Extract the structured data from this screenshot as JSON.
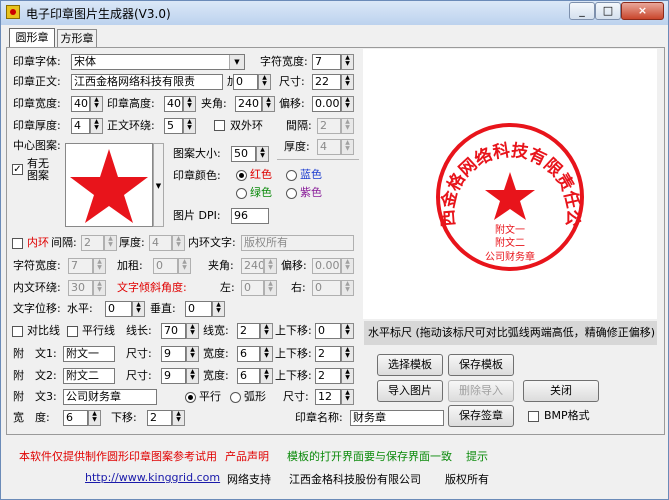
{
  "window": {
    "title": "电子印章图片生成器(V3.0)",
    "minimize": "_",
    "maximize": "□",
    "close": "×"
  },
  "tabs": [
    {
      "label": "圆形章",
      "active": true
    },
    {
      "label": "方形章",
      "active": false
    }
  ],
  "form": {
    "font_label": "印章字体:",
    "font_value": "宋体",
    "char_width_label": "字符宽度:",
    "char_width_value": "7",
    "main_text_label": "印章正文:",
    "main_text_value": "江西金格网络科技有限责",
    "bold_label": "加租:",
    "bold_value": "0",
    "size_label": "尺寸:",
    "size_value": "22",
    "stamp_width_label": "印章宽度:",
    "stamp_width_value": "40",
    "stamp_height_label": "印章高度:",
    "stamp_height_value": "40",
    "angle_label": "夹角:",
    "angle_value": "240",
    "offset_label": "偏移:",
    "offset_value": "0.000",
    "thickness_label": "印章厚度:",
    "thickness_value": "4",
    "ring_label": "正文环绕:",
    "ring_value": "5",
    "double_ring_label": "双外环",
    "gap_label": "間隔:",
    "gap_value": "2",
    "thickness2_label": "厚度:",
    "thickness2_value": "4",
    "center_label": "中心图案:",
    "has_pattern_label": "有无图案",
    "pattern_size_label": "图案大小:",
    "pattern_size_value": "50",
    "color_label": "印章颜色:",
    "colors": {
      "red": "红色",
      "blue": "蓝色",
      "green": "绿色",
      "purple": "紫色"
    },
    "dpi_label": "图片 DPI:",
    "dpi_value": "96",
    "inner_ring_label": "内环",
    "inner_gap_label": "间隔:",
    "inner_gap_value": "2",
    "inner_thick_label": "厚度:",
    "inner_thick_value": "4",
    "inner_text_label": "内环文字:",
    "inner_text_value": "版权所有",
    "char_w2_label": "字符宽度:",
    "char_w2_value": "7",
    "bold2_label": "加租:",
    "bold2_value": "0",
    "angle2_label": "夹角:",
    "angle2_value": "240",
    "offset2_label": "偏移:",
    "offset2_value": "0.000",
    "inner_wrap_label": "内文环绕:",
    "inner_wrap_value": "30",
    "tilt_label": "文字倾斜角度:",
    "left_label": "左:",
    "left_value": "0",
    "right_label": "右:",
    "right_value": "0",
    "shift_label": "文字位移:",
    "h_label": "水平:",
    "h_value": "0",
    "v_label": "垂直:",
    "v_value": "0",
    "contrast_label": "对比线",
    "parallel_label": "平行线",
    "line_len_label": "线长:",
    "line_len_value": "70",
    "line_w_label": "线宽:",
    "line_w_value": "2",
    "updown_label": "上下移:",
    "updown_value": "0",
    "sub1_label": "附　文1:",
    "sub1_value": "附文一",
    "sub1_size_label": "尺寸:",
    "sub1_size_value": "9",
    "sub1_w_label": "宽度:",
    "sub1_w_value": "6",
    "sub1_ud_label": "上下移:",
    "sub1_ud_value": "2",
    "sub2_label": "附　文2:",
    "sub2_value": "附文二",
    "sub2_size_label": "尺寸:",
    "sub2_size_value": "9",
    "sub2_w_label": "宽度:",
    "sub2_w_value": "6",
    "sub2_ud_label": "上下移:",
    "sub2_ud_value": "2",
    "sub3_label": "附　文3:",
    "sub3_value": "公司财务章",
    "parallel2_label": "平行",
    "arc_label": "弧形",
    "sub3_size_label": "尺寸:",
    "sub3_size_value": "12",
    "width_label": "宽　度:",
    "width_value": "6",
    "down_label": "下移:",
    "down_value": "2",
    "stamp_name_label": "印章名称:",
    "stamp_name_value": "财务章",
    "bmp_label": "BMP格式"
  },
  "preview": {
    "ring_text": "江西金格网络科技有限责任公司",
    "sub1": "附文一",
    "sub2": "附文二",
    "sub3": "公司财务章",
    "scale_label": "水平标尺 (拖动该标尺可对比弧线两端高低，精确修正偏移)"
  },
  "buttons": {
    "choose_template": "选择模板",
    "save_template": "保存模板",
    "import_image": "导入图片",
    "delete_import": "删除导入",
    "close": "关闭",
    "save_stamp": "保存签章"
  },
  "footer": {
    "notice": "本软件仅提供制作圆形印章图案参考试用",
    "product": "产品声明",
    "consistency": "模板的打开界面要与保存界面一致",
    "tip": "提示",
    "url": "http://www.kinggrid.com",
    "support": "网络支持",
    "company": "江西金格科技股份有限公司",
    "rights": "版权所有"
  },
  "colors": {
    "stamp_red": "#e8141b",
    "notice_red": "#d81414",
    "green": "#0a8a0a",
    "link_blue": "#1a1aaa"
  }
}
